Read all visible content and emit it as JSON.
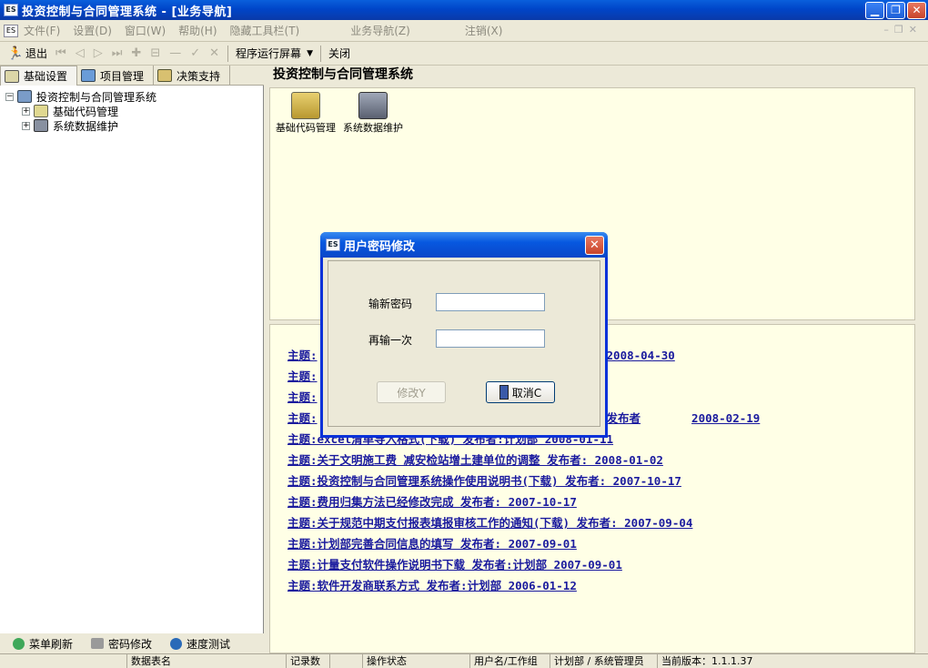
{
  "window": {
    "title": "投资控制与合同管理系统 - [业务导航]",
    "app_icon": "ES"
  },
  "menu": {
    "items": [
      "文件(F)",
      "设置(D)",
      "窗口(W)",
      "帮助(H)",
      "隐藏工具栏(T)",
      "业务导航(Z)",
      "注销(X)"
    ]
  },
  "toolbar": {
    "exit_label": "退出",
    "run_screen_label": "程序运行屏幕",
    "close_label": "关闭"
  },
  "left_tabs": [
    "基础设置",
    "项目管理",
    "决策支持"
  ],
  "tree": {
    "root": "投资控制与合同管理系统",
    "children": [
      "基础代码管理",
      "系统数据维护"
    ]
  },
  "left_bottom": [
    "菜单刷新",
    "密码修改",
    "速度测试"
  ],
  "right": {
    "header": "投资控制与合同管理系统",
    "icons": [
      {
        "label": "基础代码管理"
      },
      {
        "label": "系统数据维护"
      }
    ],
    "news": [
      "主题:",
      "主题:",
      "主题:",
      "主题:",
      "主题:excel清单导入格式(下载)    发布者:计划部  2008-01-11",
      "主题:关于文明施工费 减安检站增土建单位的调整    发布者:     2008-01-02",
      "主题:投资控制与合同管理系统操作使用说明书(下载)    发布者:     2007-10-17",
      "主题:费用归集方法已经修改完成    发布者:     2007-10-17",
      "主题:关于规范中期支付报表填报审核工作的通知(下载)    发布者:     2007-09-04",
      "主题:计划部完善合同信息的填写    发布者:     2007-09-01",
      "主题:计量支付软件操作说明书下载    发布者:计划部  2007-09-01",
      "主题:软件开发商联系方式    发布者:计划部  2006-01-12"
    ],
    "news_extra": {
      "line1_date": "2008-04-30",
      "line4_publisher": "发布者",
      "line4_date": "2008-02-19"
    }
  },
  "dialog": {
    "title": "用户密码修改",
    "new_password_label": "输新密码",
    "repeat_label": "再输一次",
    "modify_button": "修改Y",
    "cancel_button": "取消C"
  },
  "statusbar": {
    "cells": [
      "数据表名",
      "记录数",
      "操作状态",
      "用户名/工作组",
      "计划部 / 系统管理员",
      "当前版本：1.1.1.37"
    ]
  }
}
